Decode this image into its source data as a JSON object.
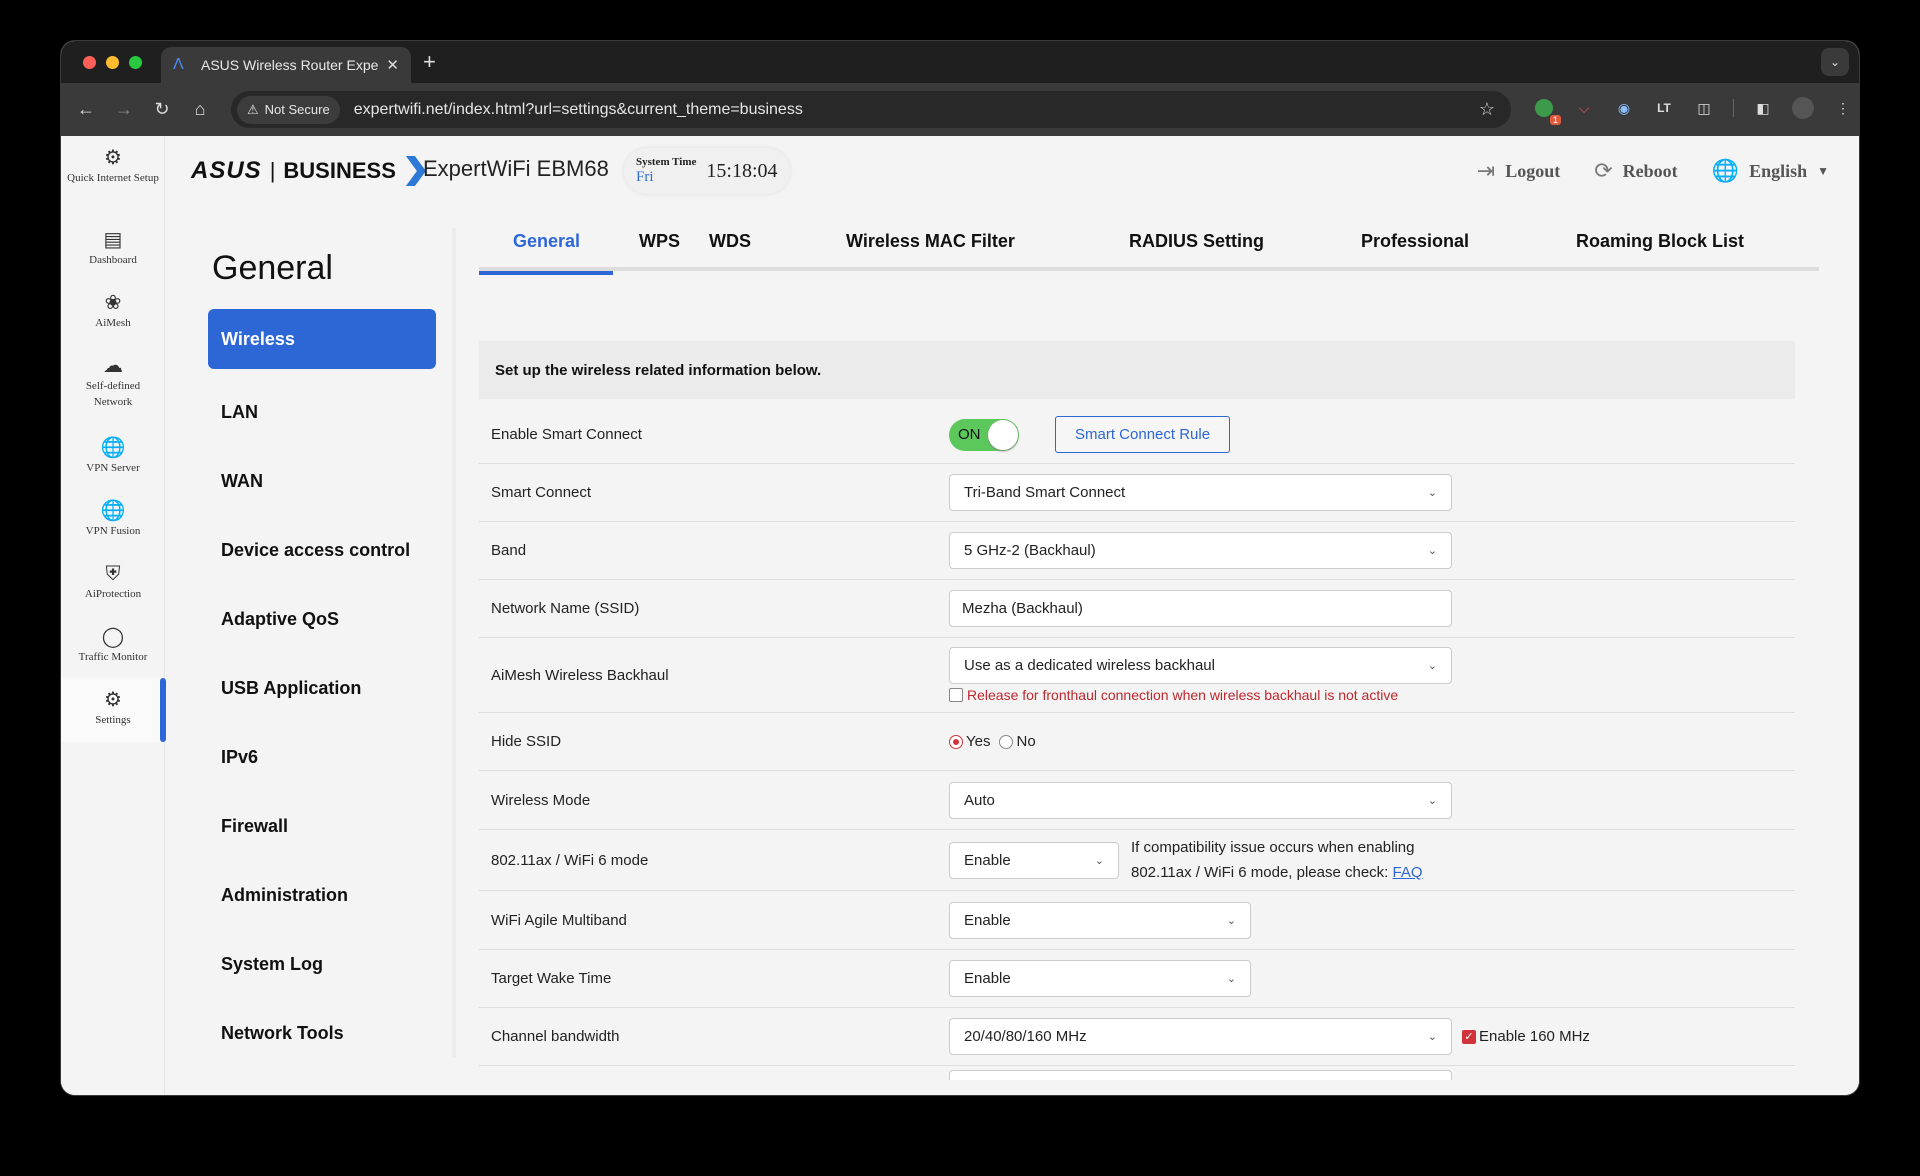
{
  "browser": {
    "tab_title": "ASUS Wireless Router Expert",
    "security_label": "Not Secure",
    "url": "expertwifi.net/index.html?url=settings&current_theme=business",
    "extension_badge": "1"
  },
  "header": {
    "brand": "ASUS",
    "brand_suffix": "BUSINESS",
    "model": "ExpertWiFi EBM68",
    "system_time_label": "System Time",
    "system_day": "Fri",
    "system_clock": "15:18:04",
    "logout": "Logout",
    "reboot": "Reboot",
    "language": "English"
  },
  "left_nav": [
    {
      "label": "Quick Internet Setup",
      "icon": "quick-setup-icon"
    },
    {
      "label": "Dashboard",
      "icon": "dashboard-icon"
    },
    {
      "label": "AiMesh",
      "icon": "aimesh-icon"
    },
    {
      "label": "Self-defined Network",
      "icon": "sdn-icon"
    },
    {
      "label": "VPN Server",
      "icon": "vpn-server-icon"
    },
    {
      "label": "VPN Fusion",
      "icon": "vpn-fusion-icon"
    },
    {
      "label": "AiProtection",
      "icon": "aiprotection-icon"
    },
    {
      "label": "Traffic Monitor",
      "icon": "traffic-monitor-icon"
    },
    {
      "label": "Settings",
      "icon": "settings-icon",
      "active": true
    }
  ],
  "section_title": "General",
  "sub_nav": [
    "Wireless",
    "LAN",
    "WAN",
    "Device access control",
    "Adaptive QoS",
    "USB Application",
    "IPv6",
    "Firewall",
    "Administration",
    "System Log",
    "Network Tools"
  ],
  "tabs": [
    "General",
    "WPS",
    "WDS",
    "Wireless MAC Filter",
    "RADIUS Setting",
    "Professional",
    "Roaming Block List"
  ],
  "active_tab": "General",
  "info_text": "Set up the wireless related information below.",
  "form": {
    "enable_smart_connect": {
      "label": "Enable Smart Connect",
      "toggle": "ON",
      "button": "Smart Connect Rule"
    },
    "smart_connect": {
      "label": "Smart Connect",
      "value": "Tri-Band Smart Connect"
    },
    "band": {
      "label": "Band",
      "value": "5 GHz-2 (Backhaul)"
    },
    "ssid": {
      "label": "Network Name (SSID)",
      "value": "Mezha (Backhaul)"
    },
    "aimesh_backhaul": {
      "label": "AiMesh Wireless Backhaul",
      "value": "Use as a dedicated wireless backhaul",
      "note": "Release for fronthaul connection when wireless backhaul is not active",
      "note_checked": false
    },
    "hide_ssid": {
      "label": "Hide SSID",
      "options": [
        "Yes",
        "No"
      ],
      "selected": "Yes"
    },
    "wireless_mode": {
      "label": "Wireless Mode",
      "value": "Auto"
    },
    "wifi6_mode": {
      "label": "802.11ax / WiFi 6 mode",
      "value": "Enable",
      "help_line1": "If compatibility issue occurs when enabling",
      "help_line2": "802.11ax / WiFi 6 mode, please check: ",
      "help_link": "FAQ"
    },
    "agile_multiband": {
      "label": "WiFi Agile Multiband",
      "value": "Enable"
    },
    "target_wake_time": {
      "label": "Target Wake Time",
      "value": "Enable"
    },
    "channel_bandwidth": {
      "label": "Channel bandwidth",
      "value": "20/40/80/160 MHz",
      "extra": "Enable 160 MHz",
      "extra_checked": true
    }
  }
}
